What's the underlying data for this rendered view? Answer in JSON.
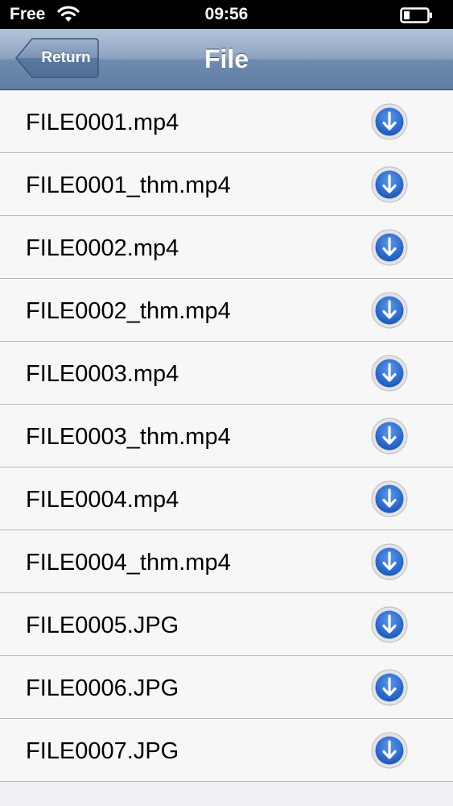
{
  "status_bar": {
    "carrier": "Free",
    "time": "09:56",
    "wifi_icon": "wifi-icon",
    "battery_icon": "battery-icon"
  },
  "nav_bar": {
    "back_label": "Return",
    "title": "File"
  },
  "files": [
    {
      "name": "FILE0001.mp4",
      "icon": "download-icon"
    },
    {
      "name": "FILE0001_thm.mp4",
      "icon": "download-icon"
    },
    {
      "name": "FILE0002.mp4",
      "icon": "download-icon"
    },
    {
      "name": "FILE0002_thm.mp4",
      "icon": "download-icon"
    },
    {
      "name": "FILE0003.mp4",
      "icon": "download-icon"
    },
    {
      "name": "FILE0003_thm.mp4",
      "icon": "download-icon"
    },
    {
      "name": "FILE0004.mp4",
      "icon": "download-icon"
    },
    {
      "name": "FILE0004_thm.mp4",
      "icon": "download-icon"
    },
    {
      "name": "FILE0005.JPG",
      "icon": "download-icon"
    },
    {
      "name": "FILE0006.JPG",
      "icon": "download-icon"
    },
    {
      "name": "FILE0007.JPG",
      "icon": "download-icon"
    }
  ],
  "colors": {
    "nav_gradient_top": "#b5c5d9",
    "nav_gradient_bottom": "#5f7da3",
    "download_blue": "#2d6fd6",
    "list_background": "#efeff4"
  }
}
